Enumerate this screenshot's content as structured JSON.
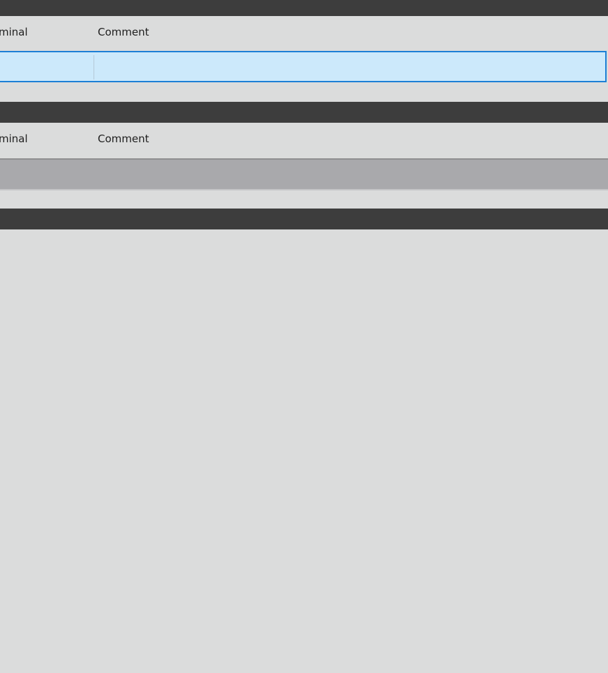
{
  "sections": [
    {
      "columns": {
        "terminal": "minal",
        "comment": "Comment"
      },
      "rows": [
        {
          "terminal": "",
          "comment": "",
          "selected": true
        }
      ]
    },
    {
      "columns": {
        "terminal": "minal",
        "comment": "Comment"
      },
      "rows": [
        {
          "terminal": "",
          "comment": "",
          "selected": false
        }
      ]
    },
    {
      "columns": null,
      "rows": []
    }
  ],
  "colors": {
    "background": "#dbdcdc",
    "section_bar": "#3d3d3d",
    "selected_row_fill": "#cce9fb",
    "selected_row_border": "#1c7fd6",
    "empty_row_fill": "#a9a9ac"
  }
}
